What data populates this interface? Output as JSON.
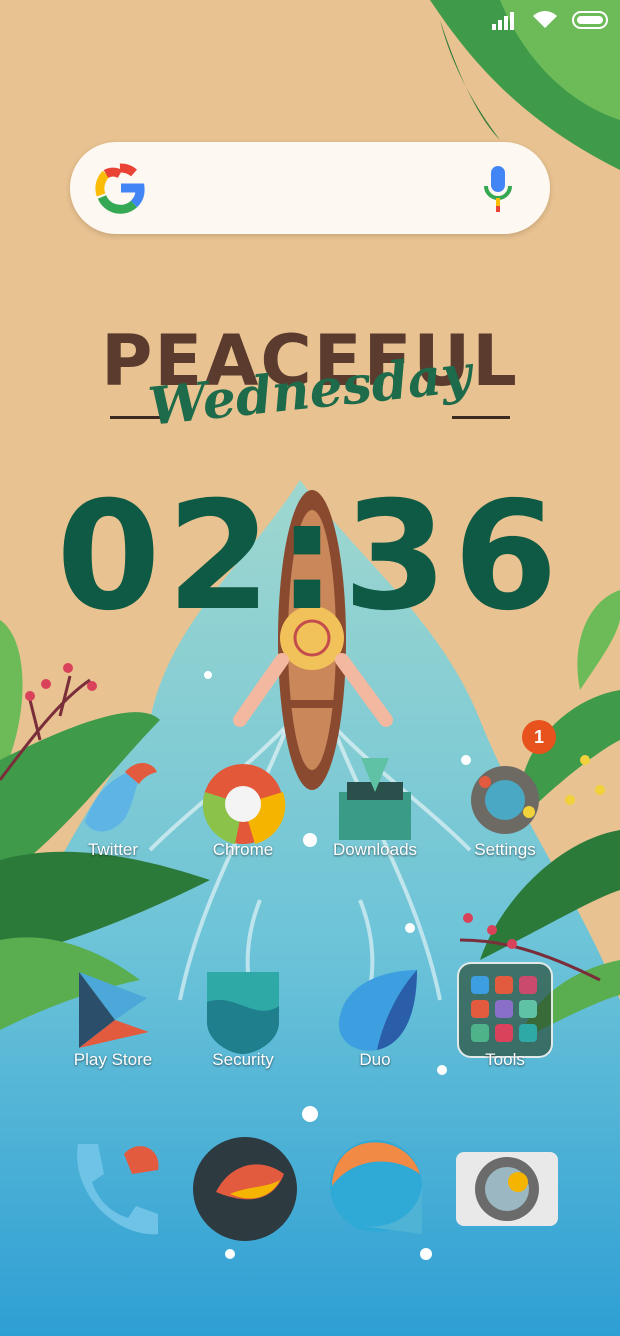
{
  "status_bar": {
    "icons": [
      "signal-icon",
      "wifi-icon",
      "battery-icon"
    ]
  },
  "search_widget": {
    "logo": "google-logo-icon",
    "mic": "mic-icon"
  },
  "widget": {
    "title": "PEACEFUL",
    "subtitle": "Wednesday",
    "time": "02:36"
  },
  "apps_row1": [
    {
      "label": "Twitter",
      "icon": "twitter-icon"
    },
    {
      "label": "Chrome",
      "icon": "chrome-icon"
    },
    {
      "label": "Downloads",
      "icon": "downloads-icon"
    },
    {
      "label": "Settings",
      "icon": "settings-icon",
      "badge": "1"
    }
  ],
  "apps_row2": [
    {
      "label": "Play Store",
      "icon": "play-store-icon"
    },
    {
      "label": "Security",
      "icon": "security-icon"
    },
    {
      "label": "Duo",
      "icon": "duo-icon"
    },
    {
      "label": "Tools",
      "icon": "tools-folder-icon"
    }
  ],
  "dock": [
    {
      "icon": "phone-icon"
    },
    {
      "icon": "browser-icon"
    },
    {
      "icon": "messages-icon"
    },
    {
      "icon": "camera-icon"
    }
  ],
  "colors": {
    "sand": "#e8c290",
    "river": "#4fb3d6",
    "leaf": "#3f9a4a",
    "clock": "#0e5a44",
    "badge": "#e8521c"
  }
}
